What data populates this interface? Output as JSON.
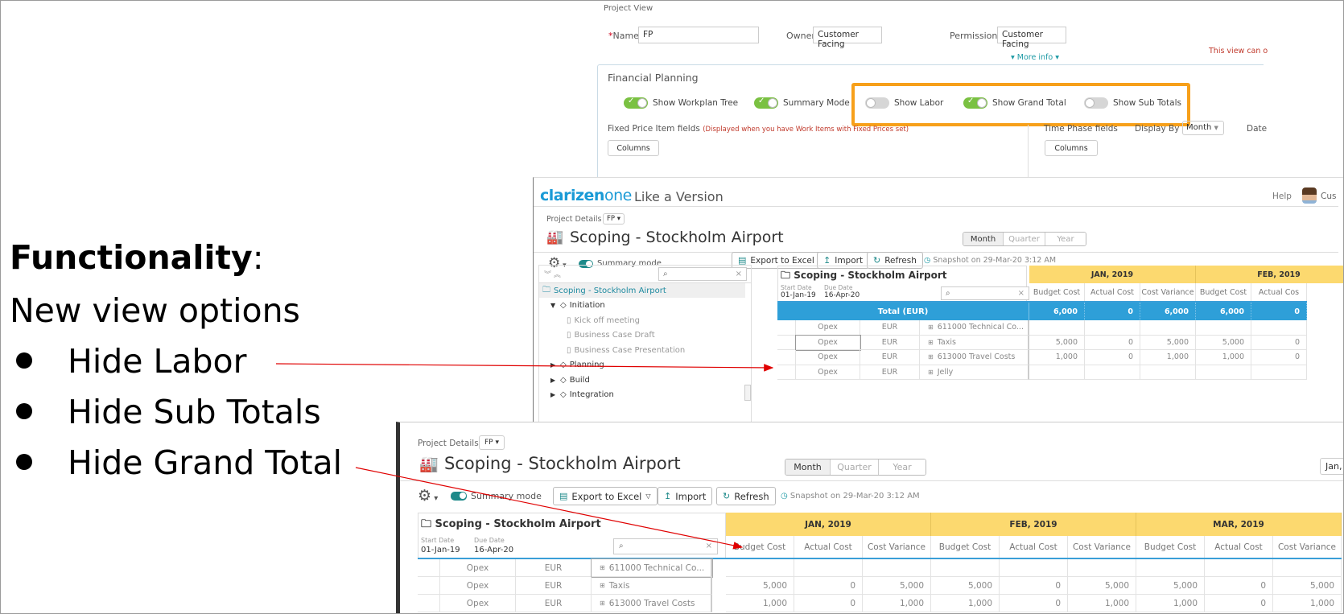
{
  "slide": {
    "title_bold": "Functionality",
    "title_suffix": ":",
    "subtitle": "New view options",
    "bullets": [
      "Hide Labor",
      "Hide Sub Totals",
      "Hide Grand Total"
    ]
  },
  "project_view": {
    "section_label": "Project View",
    "name_label": "Name",
    "name_required_mark": "*",
    "name_value": "FP",
    "owner_label": "Owner",
    "owner_value": "Customer Facing",
    "permissions_label": "Permissions",
    "permissions_value": "Customer Facing",
    "more_info": "▾ More info ▾",
    "warning": "This view can o",
    "financial_planning": {
      "title": "Financial Planning",
      "toggles": [
        {
          "label": "Show Workplan Tree",
          "on": true
        },
        {
          "label": "Summary Mode",
          "on": true
        },
        {
          "label": "Show Labor",
          "on": false
        },
        {
          "label": "Show Grand Total",
          "on": true
        },
        {
          "label": "Show Sub Totals",
          "on": false
        }
      ],
      "fixed_price_label": "Fixed Price Item fields",
      "fixed_price_note": "(Displayed when you have Work Items with Fixed Prices set)",
      "columns_button": "Columns",
      "time_phase_label": "Time Phase fields",
      "display_by_label": "Display By",
      "display_by_value": "Month",
      "date_label": "Date",
      "time_phase_columns_button": "Columns"
    }
  },
  "upper_app": {
    "logo_main": "clarizen",
    "logo_suffix": "one",
    "app_title": "Like a Version",
    "help": "Help",
    "user": "Cus",
    "breadcrumb": "Project Details ·",
    "view_select": "FP ▾",
    "project_title": "Scoping - Stockholm Airport",
    "period_tabs": [
      {
        "label": "Month",
        "active": true
      },
      {
        "label": "Quarter",
        "active": false
      },
      {
        "label": "Year",
        "active": false
      }
    ],
    "summary_mode": "Summary mode",
    "toolbar": {
      "export": "Export to Excel",
      "import": "Import",
      "refresh": "Refresh",
      "snapshot": "Snapshot on 29-Mar-20 3:12 AM"
    },
    "tree": {
      "items": [
        {
          "label": "Scoping - Stockholm Airport",
          "level": 0,
          "selected": true,
          "icon": "project-icon"
        },
        {
          "label": "Initiation",
          "level": 1,
          "expanded": true,
          "icon": "milestone-icon"
        },
        {
          "label": "Kick off meeting",
          "level": 2,
          "icon": "task-icon"
        },
        {
          "label": "Business Case Draft",
          "level": 2,
          "icon": "task-icon"
        },
        {
          "label": "Business Case Presentation",
          "level": 2,
          "icon": "task-icon"
        },
        {
          "label": "Planning",
          "level": 1,
          "expanded": false,
          "icon": "milestone-icon"
        },
        {
          "label": "Build",
          "level": 1,
          "expanded": false,
          "icon": "milestone-icon"
        },
        {
          "label": "Integration",
          "level": 1,
          "expanded": false,
          "icon": "milestone-icon"
        }
      ]
    },
    "grid": {
      "project_name": "Scoping - Stockholm Airport",
      "start_date_label": "Start Date",
      "start_date": "01-Jan-19",
      "due_date_label": "Due Date",
      "due_date": "16-Apr-20",
      "total_label": "Total (EUR)",
      "months": [
        "JAN, 2019",
        "FEB, 2019"
      ],
      "columns": [
        "Budget Cost",
        "Actual Cost",
        "Cost Variance",
        "Budget Cost",
        "Actual Cos"
      ],
      "totals": [
        "6,000",
        "0",
        "6,000",
        "6,000",
        "0"
      ],
      "rows": [
        {
          "type": "Opex",
          "currency": "EUR",
          "item": "611000 Technical Co...",
          "values": [
            "",
            "",
            "",
            "",
            ""
          ]
        },
        {
          "type": "Opex",
          "currency": "EUR",
          "item": "Taxis",
          "values": [
            "5,000",
            "0",
            "5,000",
            "5,000",
            "0"
          ]
        },
        {
          "type": "Opex",
          "currency": "EUR",
          "item": "613000 Travel Costs",
          "values": [
            "1,000",
            "0",
            "1,000",
            "1,000",
            "0"
          ]
        },
        {
          "type": "Opex",
          "currency": "EUR",
          "item": "Jelly",
          "values": [
            "",
            "",
            "",
            "",
            ""
          ]
        }
      ]
    }
  },
  "lower_app": {
    "breadcrumb": "Project Details ·",
    "view_select": "FP ▾",
    "project_title": "Scoping - Stockholm Airport",
    "period_tabs": [
      {
        "label": "Month",
        "active": true
      },
      {
        "label": "Quarter",
        "active": false
      },
      {
        "label": "Year",
        "active": false
      }
    ],
    "date_button": "Jan,",
    "summary_mode": "Summary mode",
    "toolbar": {
      "export": "Export to Excel",
      "import": "Import",
      "refresh": "Refresh",
      "snapshot": "Snapshot on 29-Mar-20 3:12 AM"
    },
    "grid": {
      "project_name": "Scoping - Stockholm Airport",
      "start_date_label": "Start Date",
      "start_date": "01-Jan-19",
      "due_date_label": "Due Date",
      "due_date": "16-Apr-20",
      "months": [
        "JAN, 2019",
        "FEB, 2019",
        "MAR, 2019"
      ],
      "columns": [
        "Budget Cost",
        "Actual Cost",
        "Cost Variance",
        "Budget Cost",
        "Actual Cost",
        "Cost Variance",
        "Budget Cost",
        "Actual Cost",
        "Cost Variance"
      ],
      "rows": [
        {
          "type": "Opex",
          "currency": "EUR",
          "item": "611000 Technical Co...",
          "values": [
            "",
            "",
            "",
            "",
            "",
            "",
            "",
            "",
            ""
          ]
        },
        {
          "type": "Opex",
          "currency": "EUR",
          "item": "Taxis",
          "values": [
            "5,000",
            "0",
            "5,000",
            "5,000",
            "0",
            "5,000",
            "5,000",
            "0",
            "5,000"
          ]
        },
        {
          "type": "Opex",
          "currency": "EUR",
          "item": "613000 Travel Costs",
          "values": [
            "1,000",
            "0",
            "1,000",
            "1,000",
            "0",
            "1,000",
            "1,000",
            "0",
            "1,000"
          ]
        }
      ]
    }
  },
  "colors": {
    "accent_orange": "#f7a01a",
    "arrow_red": "#e00000",
    "toggle_green": "#7ac142",
    "month_header": "#fcd96f",
    "total_row_blue": "#2e9fd8",
    "brand_blue": "#1a9ad6"
  }
}
